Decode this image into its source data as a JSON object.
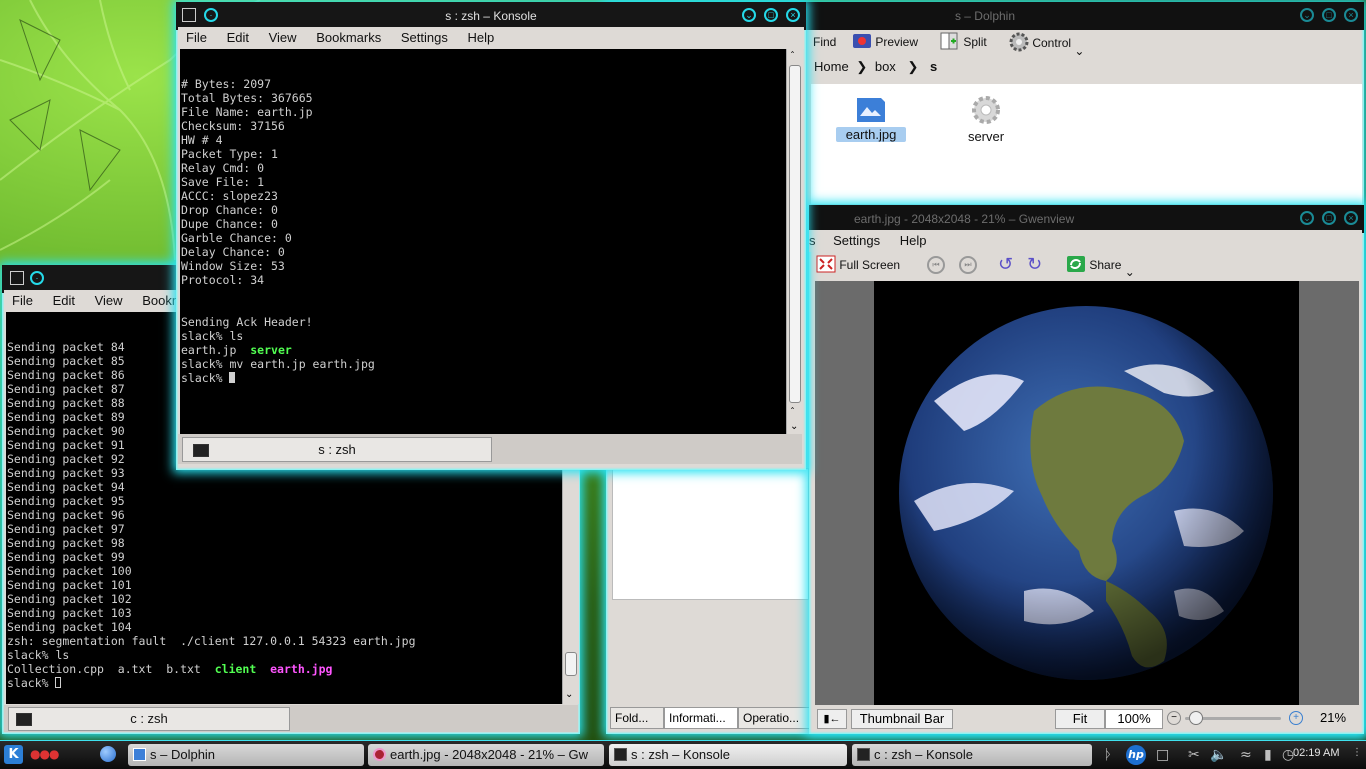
{
  "colors": {
    "accent": "#27e2f2",
    "terminal_bg": "#000000",
    "executable_green": "#52ff52",
    "image_magenta": "#ff55ff",
    "wallpaper_green": "#6cc22a"
  },
  "konsole_server": {
    "title": "s : zsh – Konsole",
    "menu": [
      "File",
      "Edit",
      "View",
      "Bookmarks",
      "Settings",
      "Help"
    ],
    "lines": [
      "# Bytes: 2097",
      "Total Bytes: 367665",
      "File Name: earth.jp",
      "Checksum: 37156",
      "HW # 4",
      "Packet Type: 1",
      "Relay Cmd: 0",
      "Save File: 1",
      "ACCC: slopez23",
      "Drop Chance: 0",
      "Dupe Chance: 0",
      "Garble Chance: 0",
      "Delay Chance: 0",
      "Window Size: 53",
      "Protocol: 34",
      "",
      "",
      "Sending Ack Header!",
      "slack% ls"
    ],
    "ls_file": "earth.jp",
    "ls_dir": "server",
    "mv_cmd": "slack% mv earth.jp earth.jpg",
    "prompt": "slack% ",
    "tab_label": "s : zsh"
  },
  "konsole_client": {
    "menu": [
      "File",
      "Edit",
      "View",
      "Bookm"
    ],
    "lines": [
      "Sending packet 84",
      "Sending packet 85",
      "Sending packet 86",
      "Sending packet 87",
      "Sending packet 88",
      "Sending packet 89",
      "Sending packet 90",
      "Sending packet 91",
      "Sending packet 92",
      "Sending packet 93",
      "Sending packet 94",
      "Sending packet 95",
      "Sending packet 96",
      "Sending packet 97",
      "Sending packet 98",
      "Sending packet 99",
      "Sending packet 100",
      "Sending packet 101",
      "Sending packet 102",
      "Sending packet 103",
      "Sending packet 104",
      "zsh: segmentation fault  ./client 127.0.0.1 54323 earth.jpg",
      "slack% ls"
    ],
    "ls_plain": "Collection.cpp  a.txt  b.txt  ",
    "ls_exec": "client",
    "ls_image": "earth.jpg",
    "prompt": "slack% ",
    "tab_label": "c : zsh"
  },
  "dolphin": {
    "title": "s – Dolphin",
    "toolbar": {
      "find": "Find",
      "preview": "Preview",
      "split": "Split",
      "control": "Control"
    },
    "breadcrumb": [
      "Home",
      "box",
      "s"
    ],
    "files": [
      {
        "name": "earth.jpg",
        "icon": "image-file-icon"
      },
      {
        "name": "server",
        "icon": "executable-gear-icon"
      }
    ],
    "panel_tabs": [
      "Fold...",
      "Informati...",
      "Operatio..."
    ]
  },
  "gwenview": {
    "title": "earth.jpg - 2048x2048 - 21% – Gwenview",
    "menu": [
      "s",
      "Settings",
      "Help"
    ],
    "toolbar": {
      "fullscreen": "Full Screen",
      "share": "Share"
    },
    "statusbar": {
      "thumbnail_bar": "Thumbnail Bar",
      "fit": "Fit",
      "zoom_100": "100%",
      "zoom_level": "21%"
    }
  },
  "taskbar": {
    "tasks": [
      "s – Dolphin",
      "earth.jpg - 2048x2048 - 21% – Gw",
      "s : zsh – Konsole",
      "c : zsh – Konsole"
    ],
    "clock": "02:19 AM"
  }
}
